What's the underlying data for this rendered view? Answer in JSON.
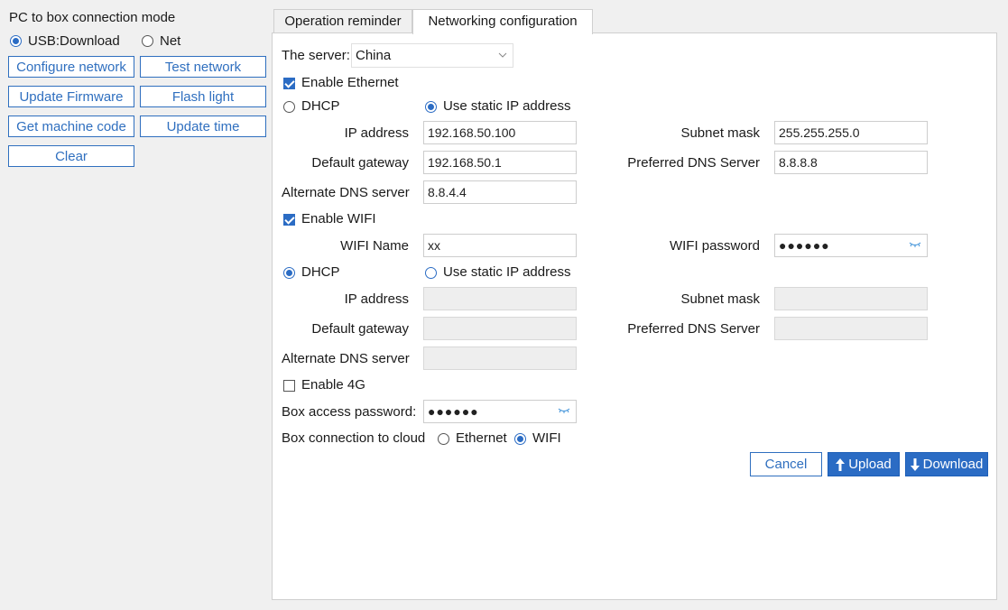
{
  "left": {
    "title": "PC to box connection mode",
    "mode_usb": "USB:Download",
    "mode_net": "Net",
    "btn_configure_network": "Configure network",
    "btn_test_network": "Test network",
    "btn_update_firmware": "Update Firmware",
    "btn_flash_light": "Flash light",
    "btn_get_machine_code": "Get machine code",
    "btn_update_time": "Update time",
    "btn_clear": "Clear"
  },
  "tabs": {
    "operation_reminder": "Operation reminder",
    "networking_configuration": "Networking configuration"
  },
  "server": {
    "label": "The server:",
    "value": "China"
  },
  "ethernet": {
    "enable_label": "Enable Ethernet",
    "dhcp_label": "DHCP",
    "static_label": "Use static IP address",
    "ip_label": "IP address",
    "ip_value": "192.168.50.100",
    "subnet_label": "Subnet mask",
    "subnet_value": "255.255.255.0",
    "gateway_label": "Default gateway",
    "gateway_value": "192.168.50.1",
    "pref_dns_label": "Preferred DNS Server",
    "pref_dns_value": "8.8.8.8",
    "alt_dns_label": "Alternate DNS server",
    "alt_dns_value": "8.8.4.4"
  },
  "wifi": {
    "enable_label": "Enable WIFI",
    "name_label": "WIFI Name",
    "name_value": "xx",
    "password_label": "WIFI password",
    "password_value": "●●●●●●",
    "dhcp_label": "DHCP",
    "static_label": "Use static IP address",
    "ip_label": "IP address",
    "subnet_label": "Subnet mask",
    "gateway_label": "Default gateway",
    "pref_dns_label": "Preferred DNS Server",
    "alt_dns_label": "Alternate DNS server"
  },
  "fourg": {
    "enable_label": "Enable 4G"
  },
  "box_password": {
    "label": "Box access password:",
    "value": "●●●●●●"
  },
  "cloud": {
    "label": "Box connection to cloud",
    "ethernet": "Ethernet",
    "wifi": "WIFI"
  },
  "actions": {
    "cancel": "Cancel",
    "upload": "Upload",
    "download": "Download"
  },
  "colors": {
    "accent": "#2b6cc4",
    "border": "#2f6fbf"
  }
}
